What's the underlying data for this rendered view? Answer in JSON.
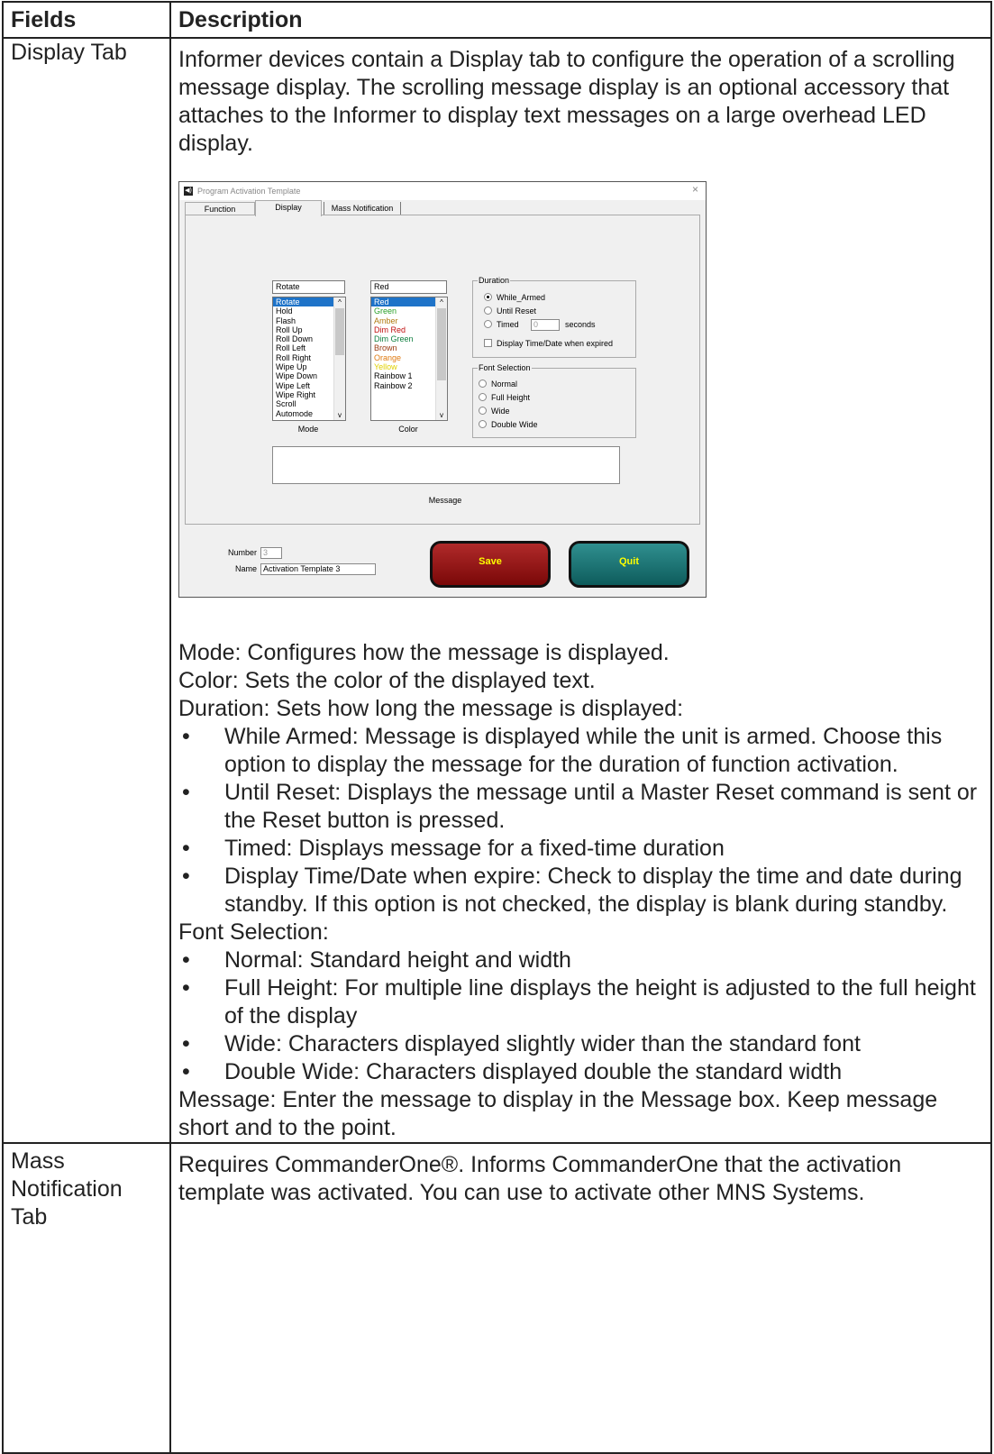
{
  "table": {
    "headers": [
      "Fields",
      "Description"
    ],
    "display_tab": {
      "field": "Display Tab",
      "intro": "Informer devices contain a Display tab to configure the operation of a scrolling message display. The scrolling message display is an optional accessory that attaches to the Informer to display text messages on a large overhead LED display.",
      "mode": "Mode: Configures how the message is displayed.",
      "color": "Color: Sets the color of the displayed text.",
      "duration": "Duration: Sets how long the message is displayed:",
      "duration_items": [
        "While Armed: Message is displayed while the unit is armed. Choose this option to display the message for the duration of function activation.",
        "Until Reset: Displays the message until a Master Reset command is sent or the Reset button is pressed.",
        "Timed: Displays message for a fixed-time duration",
        "Display Time/Date when expire: Check to display the time and date during standby. If this option is not checked, the display is blank during standby."
      ],
      "font_selection": "Font Selection:",
      "font_items": [
        "Normal: Standard height and width",
        "Full Height: For multiple line displays the height is adjusted to the full height of the display",
        "Wide: Characters displayed slightly wider than the standard font",
        "Double Wide: Characters displayed double the standard width"
      ],
      "message": "Message: Enter the message to display in the Message box. Keep message short and to the point.",
      "bullet": "•"
    },
    "mass_tab": {
      "field": "Mass Notification Tab",
      "text": "Requires CommanderOne®. Informs CommanderOne that the activation template was activated. You can use to activate other MNS Systems."
    }
  },
  "dialog": {
    "title": "Program Activation Template",
    "close": "×",
    "tabs": [
      "Function",
      "Display",
      "Mass Notification"
    ],
    "mode": {
      "value": "Rotate",
      "items": [
        "Rotate",
        "Hold",
        "Flash",
        "Roll Up",
        "Roll Down",
        "Roll Left",
        "Roll Right",
        "Wipe Up",
        "Wipe Down",
        "Wipe Left",
        "Wipe Right",
        "Scroll",
        "Automode"
      ],
      "caption": "Mode"
    },
    "color": {
      "value": "Red",
      "items": [
        "Red",
        "Green",
        "Amber",
        "Dim Red",
        "Dim Green",
        "Brown",
        "Orange",
        "Yellow",
        "Rainbow 1",
        "Rainbow 2"
      ],
      "item_colors": [
        "#ffffff",
        "#2aa02a",
        "#b07a10",
        "#c01010",
        "#108040",
        "#9a3a10",
        "#e07a10",
        "#e0d000",
        "#000000",
        "#000000"
      ],
      "caption": "Color"
    },
    "duration": {
      "legend": "Duration",
      "options": [
        "While_Armed",
        "Until Reset",
        "Timed"
      ],
      "timed_value": "0",
      "seconds": "seconds",
      "checkbox": "Display Time/Date when expired"
    },
    "font": {
      "legend": "Font Selection",
      "options": [
        "Normal",
        "Full Height",
        "Wide",
        "Double Wide"
      ]
    },
    "message_caption": "Message",
    "number_label": "Number",
    "number_value": "3",
    "name_label": "Name",
    "name_value": "Activation Template 3",
    "save": "Save",
    "quit": "Quit",
    "scroll_up": "^",
    "scroll_down": "v"
  }
}
